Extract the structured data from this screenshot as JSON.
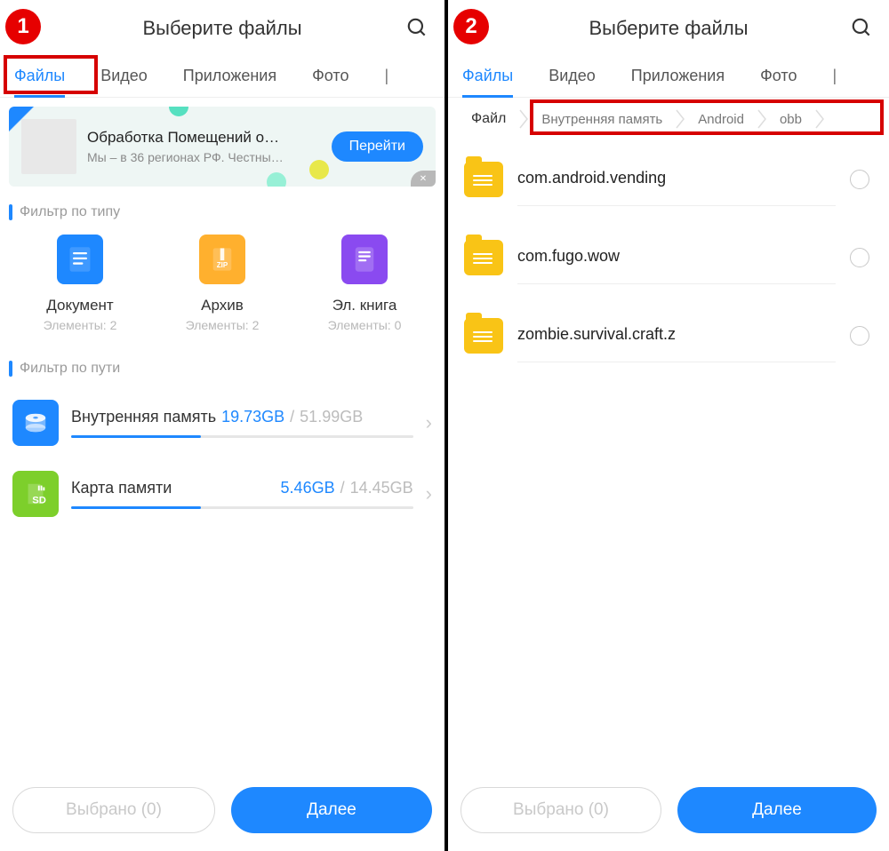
{
  "steps": [
    "1",
    "2"
  ],
  "header": {
    "title": "Выберите файлы"
  },
  "tabs": {
    "items": [
      "Файлы",
      "Видео",
      "Приложения",
      "Фото"
    ],
    "active": 0
  },
  "ad": {
    "title": "Обработка Помещений о…",
    "subtitle": "Мы – в 36 регионах РФ. Честны…",
    "cta": "Перейти"
  },
  "filter_type": {
    "label": "Фильтр по типу",
    "items": [
      {
        "name": "Документ",
        "count_label": "Элементы:",
        "count": 2,
        "color": "#1e88ff",
        "glyph": "doc"
      },
      {
        "name": "Архив",
        "count_label": "Элементы:",
        "count": 2,
        "color": "#ffb02e",
        "glyph": "zip"
      },
      {
        "name": "Эл. книга",
        "count_label": "Элементы:",
        "count": 0,
        "color": "#8a4af0",
        "glyph": "book"
      }
    ]
  },
  "filter_path": {
    "label": "Фильтр по пути",
    "storages": [
      {
        "name": "Внутренняя память",
        "used": "19.73GB",
        "total": "51.99GB",
        "pct": 38,
        "icon": "disk",
        "color": "#1e88ff"
      },
      {
        "name": "Карта памяти",
        "used": "5.46GB",
        "total": "14.45GB",
        "pct": 38,
        "icon": "sd",
        "color": "#7dcf2b"
      }
    ]
  },
  "breadcrumbs": {
    "items": [
      "Файл",
      "Внутренняя память",
      "Android",
      "obb"
    ]
  },
  "folders": {
    "items": [
      {
        "name": "com.android.vending"
      },
      {
        "name": "com.fugo.wow"
      },
      {
        "name": "zombie.survival.craft.z"
      }
    ]
  },
  "footer": {
    "selected_label": "Выбрано (0)",
    "next_label": "Далее"
  }
}
